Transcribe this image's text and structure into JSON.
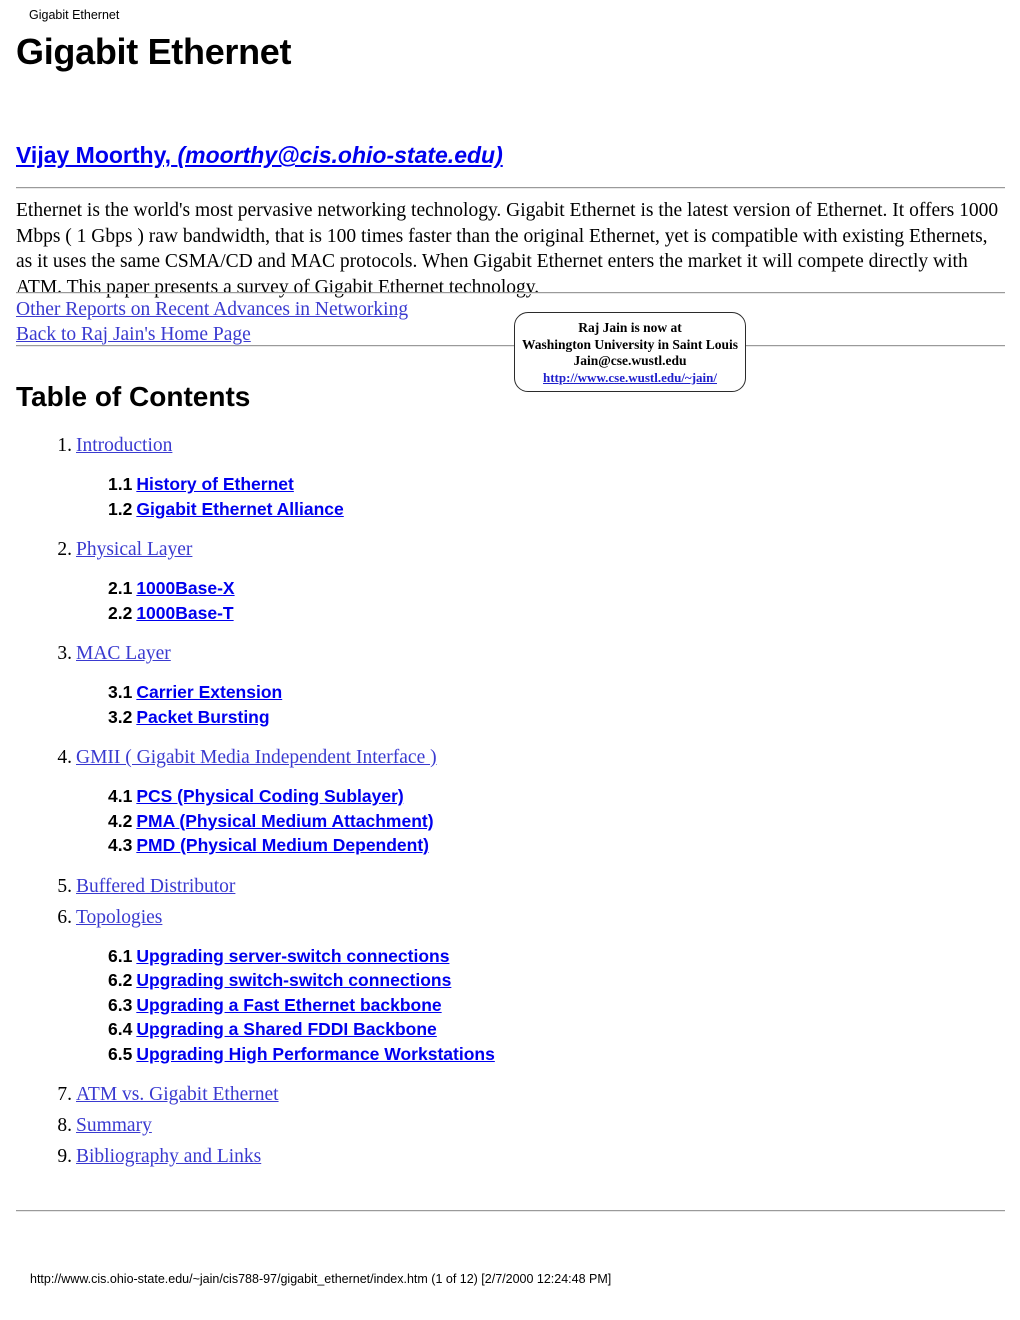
{
  "print_header": "Gigabit Ethernet",
  "title": "Gigabit Ethernet",
  "author": {
    "name": "Vijay Moorthy,",
    "email": "(moorthy@cis.ohio-state.edu)"
  },
  "abstract": "Ethernet is the world's most pervasive networking technology. Gigabit Ethernet is the latest version of Ethernet. It offers 1000 Mbps ( 1 Gbps ) raw bandwidth, that is 100 times faster than the original Ethernet, yet is compatible with existing Ethernets, as it uses the same CSMA/CD and MAC protocols. When Gigabit Ethernet enters the market it will compete directly with ATM. This paper presents a survey of Gigabit Ethernet technology.",
  "nav_links": [
    "Other Reports on Recent Advances in Networking",
    "Back to Raj Jain's Home Page"
  ],
  "jain_note": {
    "line1": "Raj Jain is now at",
    "line2": "Washington University in Saint Louis",
    "line3": "Jain@cse.wustl.edu",
    "url": "http://www.cse.wustl.edu/~jain/"
  },
  "toc_heading": "Table of Contents",
  "toc": [
    {
      "number": "1.",
      "label": "Introduction",
      "subs": [
        {
          "number": "1.1",
          "label": "History of Ethernet"
        },
        {
          "number": "1.2",
          "label": "Gigabit Ethernet Alliance"
        }
      ]
    },
    {
      "number": "2.",
      "label": "Physical Layer",
      "subs": [
        {
          "number": "2.1",
          "label": "1000Base-X"
        },
        {
          "number": "2.2",
          "label": "1000Base-T"
        }
      ]
    },
    {
      "number": "3.",
      "label": "MAC Layer",
      "subs": [
        {
          "number": "3.1",
          "label": "Carrier Extension"
        },
        {
          "number": "3.2",
          "label": "Packet Bursting"
        }
      ]
    },
    {
      "number": "4.",
      "label": "GMII ( Gigabit Media Independent Interface )",
      "subs": [
        {
          "number": "4.1",
          "label": "PCS (Physical Coding Sublayer)"
        },
        {
          "number": "4.2",
          "label": "PMA (Physical Medium Attachment)"
        },
        {
          "number": "4.3",
          "label": "PMD (Physical Medium Dependent)"
        }
      ]
    },
    {
      "number": "5.",
      "label": "Buffered Distributor",
      "subs": []
    },
    {
      "number": "6.",
      "label": "Topologies",
      "subs": [
        {
          "number": "6.1",
          "label": "Upgrading server-switch connections"
        },
        {
          "number": "6.2",
          "label": "Upgrading switch-switch connections"
        },
        {
          "number": "6.3",
          "label": "Upgrading a Fast Ethernet backbone"
        },
        {
          "number": "6.4",
          "label": "Upgrading a Shared FDDI Backbone"
        },
        {
          "number": "6.5",
          "label": "Upgrading High Performance Workstations"
        }
      ]
    },
    {
      "number": "7.",
      "label": "ATM vs. Gigabit Ethernet",
      "subs": []
    },
    {
      "number": "8.",
      "label": "Summary",
      "subs": []
    },
    {
      "number": "9.",
      "label": "Bibliography and Links",
      "subs": []
    }
  ],
  "footer": "http://www.cis.ohio-state.edu/~jain/cis788-97/gigabit_ethernet/index.htm (1 of 12) [2/7/2000 12:24:48 PM]",
  "colors": {
    "link_blue": "#0000ee",
    "link_muted_blue": "#3a3ad0",
    "rule_gray": "#9a9a9a",
    "text_black": "#000000"
  }
}
